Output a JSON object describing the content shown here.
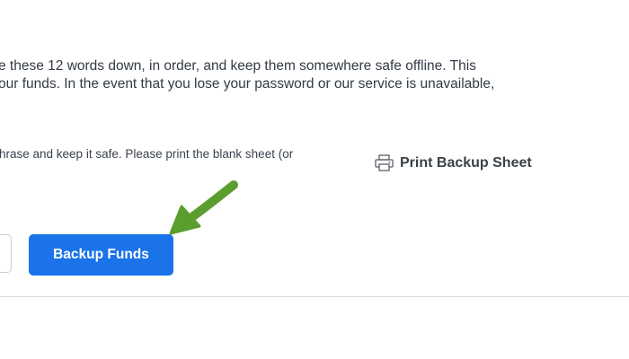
{
  "intro": {
    "line1": "e these 12 words down, in order, and keep them somewhere safe offline. This",
    "line2": "our funds. In the event that you lose your password or our service is unavailable,"
  },
  "instruction": {
    "text": "hrase and keep it safe. Please print the blank sheet (or"
  },
  "print_link": {
    "label": "Print Backup Sheet",
    "icon": "printer-icon"
  },
  "actions": {
    "backup_label": "Backup Funds"
  },
  "annotation": {
    "arrow_color": "#5a9e2f",
    "arrow_icon": "arrow-annotation-icon"
  },
  "colors": {
    "primary": "#1a73e8",
    "text": "#333a45",
    "divider": "#d7dbe1"
  }
}
